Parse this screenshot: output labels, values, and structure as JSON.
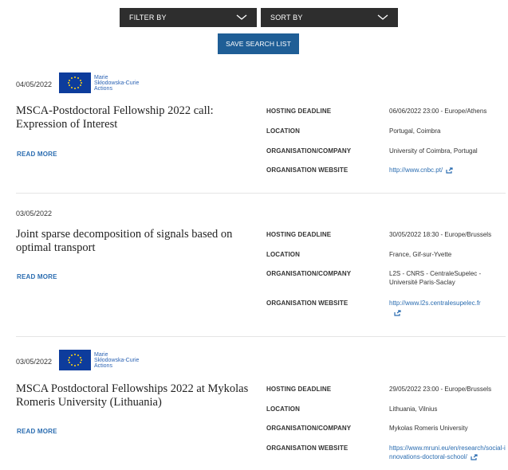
{
  "toolbar": {
    "filter_label": "FILTER BY",
    "sort_label": "SORT BY",
    "save_label": "SAVE SEARCH LIST"
  },
  "labels": {
    "deadline": "HOSTING DEADLINE",
    "location": "LOCATION",
    "organisation": "ORGANISATION/COMPANY",
    "website": "ORGANISATION WEBSITE",
    "read_more": "READ MORE"
  },
  "msca_logo": {
    "line1": "Marie",
    "line2": "Skłodowska-Curie",
    "line3": "Actions"
  },
  "colors": {
    "dropdown_bg": "#2e2e2e",
    "button_bg": "#1f5e96",
    "link": "#2a6cb0",
    "eu_flag": "#0d3c9c",
    "eu_stars": "#ffd617"
  },
  "icons": [
    "chevron-down-icon",
    "external-link-icon",
    "eu-flag-icon"
  ],
  "listings": [
    {
      "date": "04/05/2022",
      "title": "MSCA-Postdoctoral Fellowship 2022 call: Expression of Interest",
      "deadline": "06/06/2022 23:00 - Europe/Athens",
      "location": "Portugal, Coimbra",
      "organisation": "University of Coimbra, Portugal",
      "website": "http://www.cnbc.pt/"
    },
    {
      "date": "03/05/2022",
      "title": "Joint sparse decomposition of signals based on optimal transport",
      "deadline": "30/05/2022 18:30 - Europe/Brussels",
      "location": "France, Gif-sur-Yvette",
      "organisation": "L2S - CNRS - CentraleSupelec - Université Paris-Saclay",
      "website": "http://www.l2s.centralesupelec.fr"
    },
    {
      "date": "03/05/2022",
      "title": "MSCA Postdoctoral Fellowships 2022 at Mykolas Romeris University (Lithuania)",
      "deadline": "29/05/2022 23:00 - Europe/Brussels",
      "location": "Lithuania, Vilnius",
      "organisation": "Mykolas Romeris University",
      "website": "https://www.mruni.eu/en/research/social-innovations-doctoral-school/"
    }
  ]
}
